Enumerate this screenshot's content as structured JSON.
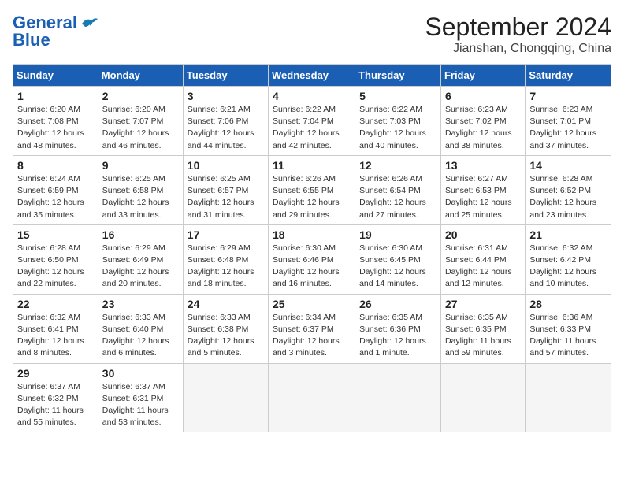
{
  "logo": {
    "text1": "General",
    "text2": "Blue"
  },
  "title": "September 2024",
  "subtitle": "Jianshan, Chongqing, China",
  "weekdays": [
    "Sunday",
    "Monday",
    "Tuesday",
    "Wednesday",
    "Thursday",
    "Friday",
    "Saturday"
  ],
  "weeks": [
    [
      {
        "day": "1",
        "info": "Sunrise: 6:20 AM\nSunset: 7:08 PM\nDaylight: 12 hours\nand 48 minutes."
      },
      {
        "day": "2",
        "info": "Sunrise: 6:20 AM\nSunset: 7:07 PM\nDaylight: 12 hours\nand 46 minutes."
      },
      {
        "day": "3",
        "info": "Sunrise: 6:21 AM\nSunset: 7:06 PM\nDaylight: 12 hours\nand 44 minutes."
      },
      {
        "day": "4",
        "info": "Sunrise: 6:22 AM\nSunset: 7:04 PM\nDaylight: 12 hours\nand 42 minutes."
      },
      {
        "day": "5",
        "info": "Sunrise: 6:22 AM\nSunset: 7:03 PM\nDaylight: 12 hours\nand 40 minutes."
      },
      {
        "day": "6",
        "info": "Sunrise: 6:23 AM\nSunset: 7:02 PM\nDaylight: 12 hours\nand 38 minutes."
      },
      {
        "day": "7",
        "info": "Sunrise: 6:23 AM\nSunset: 7:01 PM\nDaylight: 12 hours\nand 37 minutes."
      }
    ],
    [
      {
        "day": "8",
        "info": "Sunrise: 6:24 AM\nSunset: 6:59 PM\nDaylight: 12 hours\nand 35 minutes."
      },
      {
        "day": "9",
        "info": "Sunrise: 6:25 AM\nSunset: 6:58 PM\nDaylight: 12 hours\nand 33 minutes."
      },
      {
        "day": "10",
        "info": "Sunrise: 6:25 AM\nSunset: 6:57 PM\nDaylight: 12 hours\nand 31 minutes."
      },
      {
        "day": "11",
        "info": "Sunrise: 6:26 AM\nSunset: 6:55 PM\nDaylight: 12 hours\nand 29 minutes."
      },
      {
        "day": "12",
        "info": "Sunrise: 6:26 AM\nSunset: 6:54 PM\nDaylight: 12 hours\nand 27 minutes."
      },
      {
        "day": "13",
        "info": "Sunrise: 6:27 AM\nSunset: 6:53 PM\nDaylight: 12 hours\nand 25 minutes."
      },
      {
        "day": "14",
        "info": "Sunrise: 6:28 AM\nSunset: 6:52 PM\nDaylight: 12 hours\nand 23 minutes."
      }
    ],
    [
      {
        "day": "15",
        "info": "Sunrise: 6:28 AM\nSunset: 6:50 PM\nDaylight: 12 hours\nand 22 minutes."
      },
      {
        "day": "16",
        "info": "Sunrise: 6:29 AM\nSunset: 6:49 PM\nDaylight: 12 hours\nand 20 minutes."
      },
      {
        "day": "17",
        "info": "Sunrise: 6:29 AM\nSunset: 6:48 PM\nDaylight: 12 hours\nand 18 minutes."
      },
      {
        "day": "18",
        "info": "Sunrise: 6:30 AM\nSunset: 6:46 PM\nDaylight: 12 hours\nand 16 minutes."
      },
      {
        "day": "19",
        "info": "Sunrise: 6:30 AM\nSunset: 6:45 PM\nDaylight: 12 hours\nand 14 minutes."
      },
      {
        "day": "20",
        "info": "Sunrise: 6:31 AM\nSunset: 6:44 PM\nDaylight: 12 hours\nand 12 minutes."
      },
      {
        "day": "21",
        "info": "Sunrise: 6:32 AM\nSunset: 6:42 PM\nDaylight: 12 hours\nand 10 minutes."
      }
    ],
    [
      {
        "day": "22",
        "info": "Sunrise: 6:32 AM\nSunset: 6:41 PM\nDaylight: 12 hours\nand 8 minutes."
      },
      {
        "day": "23",
        "info": "Sunrise: 6:33 AM\nSunset: 6:40 PM\nDaylight: 12 hours\nand 6 minutes."
      },
      {
        "day": "24",
        "info": "Sunrise: 6:33 AM\nSunset: 6:38 PM\nDaylight: 12 hours\nand 5 minutes."
      },
      {
        "day": "25",
        "info": "Sunrise: 6:34 AM\nSunset: 6:37 PM\nDaylight: 12 hours\nand 3 minutes."
      },
      {
        "day": "26",
        "info": "Sunrise: 6:35 AM\nSunset: 6:36 PM\nDaylight: 12 hours\nand 1 minute."
      },
      {
        "day": "27",
        "info": "Sunrise: 6:35 AM\nSunset: 6:35 PM\nDaylight: 11 hours\nand 59 minutes."
      },
      {
        "day": "28",
        "info": "Sunrise: 6:36 AM\nSunset: 6:33 PM\nDaylight: 11 hours\nand 57 minutes."
      }
    ],
    [
      {
        "day": "29",
        "info": "Sunrise: 6:37 AM\nSunset: 6:32 PM\nDaylight: 11 hours\nand 55 minutes."
      },
      {
        "day": "30",
        "info": "Sunrise: 6:37 AM\nSunset: 6:31 PM\nDaylight: 11 hours\nand 53 minutes."
      },
      {
        "day": "",
        "info": ""
      },
      {
        "day": "",
        "info": ""
      },
      {
        "day": "",
        "info": ""
      },
      {
        "day": "",
        "info": ""
      },
      {
        "day": "",
        "info": ""
      }
    ]
  ]
}
